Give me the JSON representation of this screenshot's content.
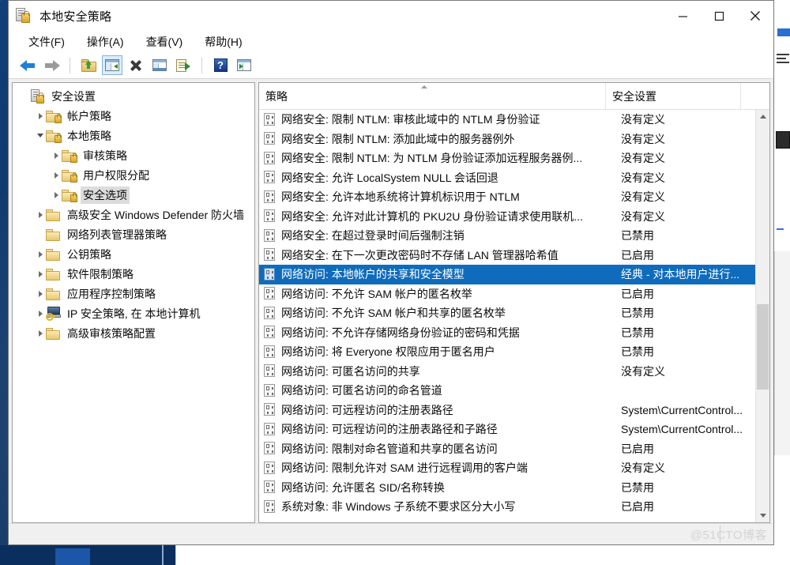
{
  "window": {
    "title": "本地安全策略",
    "title_icon": "security-settings-icon",
    "minimize_label": "—",
    "maximize_label": "□",
    "close_label": "✕"
  },
  "menubar": {
    "items": [
      {
        "label": "文件(F)",
        "name": "menu-file"
      },
      {
        "label": "操作(A)",
        "name": "menu-action"
      },
      {
        "label": "查看(V)",
        "name": "menu-view"
      },
      {
        "label": "帮助(H)",
        "name": "menu-help"
      }
    ]
  },
  "toolbar": {
    "buttons": [
      {
        "icon": "back-arrow-icon",
        "enabled": true
      },
      {
        "icon": "forward-arrow-icon",
        "enabled": false
      },
      {
        "icon": "folder-up-icon",
        "enabled": true
      },
      {
        "icon": "show-hide-tree-icon",
        "active": true
      },
      {
        "icon": "delete-icon",
        "enabled": true
      },
      {
        "icon": "properties-icon",
        "enabled": true
      },
      {
        "icon": "export-list-icon",
        "enabled": true
      },
      {
        "icon": "help-icon",
        "enabled": true
      },
      {
        "icon": "view-pane-icon",
        "enabled": true
      }
    ]
  },
  "tree": {
    "items": [
      {
        "label": "安全设置",
        "icon": "security-settings-icon",
        "indent": 0,
        "twisty": "none",
        "selected": false
      },
      {
        "label": "帐户策略",
        "icon": "locked-folder-icon",
        "indent": 1,
        "twisty": "collapsed",
        "selected": false
      },
      {
        "label": "本地策略",
        "icon": "locked-folder-icon",
        "indent": 1,
        "twisty": "expanded",
        "selected": false
      },
      {
        "label": "审核策略",
        "icon": "locked-folder-icon",
        "indent": 2,
        "twisty": "collapsed",
        "selected": false
      },
      {
        "label": "用户权限分配",
        "icon": "locked-folder-icon",
        "indent": 2,
        "twisty": "collapsed",
        "selected": false
      },
      {
        "label": "安全选项",
        "icon": "locked-folder-icon",
        "indent": 2,
        "twisty": "collapsed",
        "selected": true
      },
      {
        "label": "高级安全 Windows Defender 防火墙",
        "icon": "folder-icon",
        "indent": 1,
        "twisty": "collapsed",
        "selected": false
      },
      {
        "label": "网络列表管理器策略",
        "icon": "folder-icon",
        "indent": 1,
        "twisty": "none",
        "selected": false
      },
      {
        "label": "公钥策略",
        "icon": "folder-icon",
        "indent": 1,
        "twisty": "collapsed",
        "selected": false
      },
      {
        "label": "软件限制策略",
        "icon": "folder-icon",
        "indent": 1,
        "twisty": "collapsed",
        "selected": false
      },
      {
        "label": "应用程序控制策略",
        "icon": "folder-icon",
        "indent": 1,
        "twisty": "collapsed",
        "selected": false
      },
      {
        "label": "IP 安全策略, 在 本地计算机",
        "icon": "ipsec-icon",
        "indent": 1,
        "twisty": "collapsed",
        "selected": false
      },
      {
        "label": "高级审核策略配置",
        "icon": "folder-icon",
        "indent": 1,
        "twisty": "collapsed",
        "selected": false
      }
    ]
  },
  "list": {
    "columns": [
      {
        "label": "策略",
        "name": "column-policy",
        "sort": "asc"
      },
      {
        "label": "安全设置",
        "name": "column-security-setting"
      }
    ],
    "rows": [
      {
        "policy": "网络安全: 限制 NTLM: 审核此域中的 NTLM 身份验证",
        "setting": "没有定义",
        "selected": false
      },
      {
        "policy": "网络安全: 限制 NTLM: 添加此域中的服务器例外",
        "setting": "没有定义",
        "selected": false
      },
      {
        "policy": "网络安全: 限制 NTLM: 为 NTLM 身份验证添加远程服务器例...",
        "setting": "没有定义",
        "selected": false
      },
      {
        "policy": "网络安全: 允许 LocalSystem NULL 会话回退",
        "setting": "没有定义",
        "selected": false
      },
      {
        "policy": "网络安全: 允许本地系统将计算机标识用于 NTLM",
        "setting": "没有定义",
        "selected": false
      },
      {
        "policy": "网络安全: 允许对此计算机的 PKU2U 身份验证请求使用联机...",
        "setting": "没有定义",
        "selected": false
      },
      {
        "policy": "网络安全: 在超过登录时间后强制注销",
        "setting": "已禁用",
        "selected": false
      },
      {
        "policy": "网络安全: 在下一次更改密码时不存储 LAN 管理器哈希值",
        "setting": "已启用",
        "selected": false
      },
      {
        "policy": "网络访问: 本地帐户的共享和安全模型",
        "setting": "经典 - 对本地用户进行...",
        "selected": true
      },
      {
        "policy": "网络访问: 不允许 SAM 帐户的匿名枚举",
        "setting": "已启用",
        "selected": false
      },
      {
        "policy": "网络访问: 不允许 SAM 帐户和共享的匿名枚举",
        "setting": "已禁用",
        "selected": false
      },
      {
        "policy": "网络访问: 不允许存储网络身份验证的密码和凭据",
        "setting": "已禁用",
        "selected": false
      },
      {
        "policy": "网络访问: 将 Everyone 权限应用于匿名用户",
        "setting": "已禁用",
        "selected": false
      },
      {
        "policy": "网络访问: 可匿名访问的共享",
        "setting": "没有定义",
        "selected": false
      },
      {
        "policy": "网络访问: 可匿名访问的命名管道",
        "setting": "",
        "selected": false
      },
      {
        "policy": "网络访问: 可远程访问的注册表路径",
        "setting": "System\\CurrentControl...",
        "selected": false
      },
      {
        "policy": "网络访问: 可远程访问的注册表路径和子路径",
        "setting": "System\\CurrentControl...",
        "selected": false
      },
      {
        "policy": "网络访问: 限制对命名管道和共享的匿名访问",
        "setting": "已启用",
        "selected": false
      },
      {
        "policy": "网络访问: 限制允许对 SAM 进行远程调用的客户端",
        "setting": "没有定义",
        "selected": false
      },
      {
        "policy": "网络访问: 允许匿名 SID/名称转换",
        "setting": "已禁用",
        "selected": false
      },
      {
        "policy": "系统对象: 非 Windows 子系统不要求区分大小写",
        "setting": "已启用",
        "selected": false
      }
    ],
    "scrollbar": {
      "thumb_top_pct": 47,
      "thumb_height_pct": 22
    }
  },
  "statusbar": {
    "text": "",
    "watermark": "@51CTO博客"
  },
  "colors": {
    "selection": "#0f6cbd",
    "tree_selection": "#dcdcdc",
    "toolbar_active": "#dcecfb",
    "window_bg": "#f0f0f0",
    "desktop": "#0b3d7a"
  }
}
